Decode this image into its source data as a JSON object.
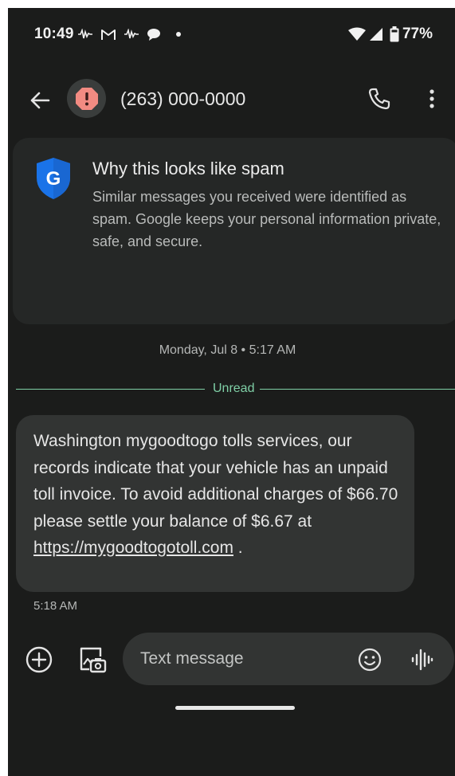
{
  "status_bar": {
    "time": "10:49",
    "battery": "77%",
    "icons": [
      "voicemail-icon",
      "gmail-icon",
      "voicemail-icon",
      "chat-bubble-icon",
      "dot-icon",
      "wifi-icon",
      "signal-icon",
      "battery-icon"
    ]
  },
  "header": {
    "contact": "(263) 000-0000",
    "avatar_icon": "spam-warning-icon",
    "actions": [
      "back-arrow-icon",
      "phone-icon",
      "more-vert-icon"
    ]
  },
  "spam_card": {
    "title": "Why this looks like spam",
    "body": "Similar messages you received were identified as spam. Google keeps your personal information private, safe, and secure.",
    "icon": "google-shield-icon",
    "icon_letter": "G"
  },
  "conversation": {
    "date_label": "Monday, Jul 8 • 5:17 AM",
    "unread_label": "Unread",
    "message": {
      "text": "Washington mygoodtogo tolls services, our records indicate that your vehicle has an unpaid toll invoice. To avoid additional charges of $66.70 please settle your balance of $6.67 at ",
      "link": "https://mygoodtogotoll.com",
      "suffix": " .",
      "time": "5:18 AM"
    }
  },
  "compose": {
    "placeholder": "Text message",
    "icons": [
      "add-circle-icon",
      "gallery-icon",
      "emoji-icon",
      "voice-icon"
    ]
  },
  "colors": {
    "background": "#1b1c1b",
    "card": "#252726",
    "bubble": "#323433",
    "unread_accent": "#7fcfa6",
    "spam_red": "#f28b82",
    "shield_blue": "#1a73e8"
  }
}
